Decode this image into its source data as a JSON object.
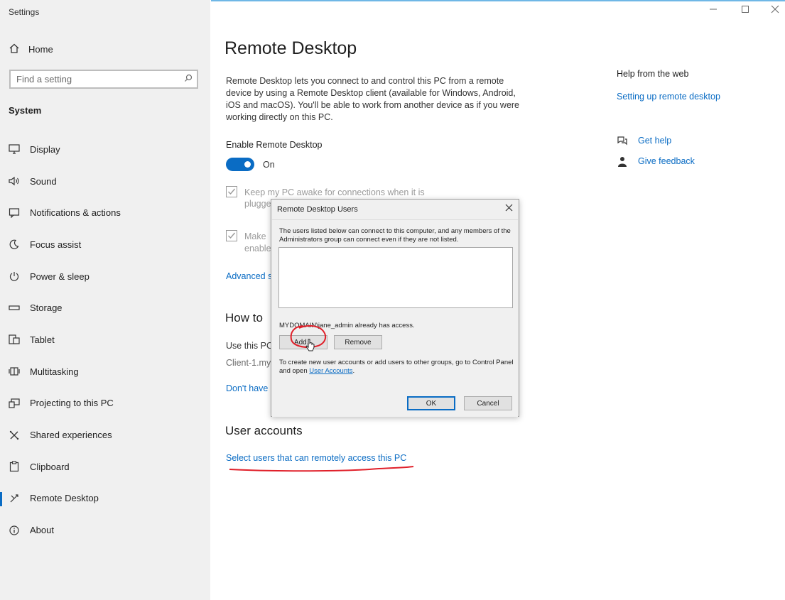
{
  "window": {
    "app_title": "Settings"
  },
  "sidebar": {
    "home_label": "Home",
    "search_placeholder": "Find a setting",
    "section_label": "System",
    "items": [
      {
        "label": "Display",
        "icon": "monitor-icon"
      },
      {
        "label": "Sound",
        "icon": "speaker-icon"
      },
      {
        "label": "Notifications & actions",
        "icon": "notification-icon"
      },
      {
        "label": "Focus assist",
        "icon": "moon-icon"
      },
      {
        "label": "Power & sleep",
        "icon": "power-icon"
      },
      {
        "label": "Storage",
        "icon": "storage-icon"
      },
      {
        "label": "Tablet",
        "icon": "tablet-icon"
      },
      {
        "label": "Multitasking",
        "icon": "multitasking-icon"
      },
      {
        "label": "Projecting to this PC",
        "icon": "projecting-icon"
      },
      {
        "label": "Shared experiences",
        "icon": "shared-icon"
      },
      {
        "label": "Clipboard",
        "icon": "clipboard-icon"
      },
      {
        "label": "Remote Desktop",
        "icon": "remote-desktop-icon",
        "active": true
      },
      {
        "label": "About",
        "icon": "info-icon"
      }
    ]
  },
  "main": {
    "title": "Remote Desktop",
    "description": "Remote Desktop lets you connect to and control this PC from a remote device by using a Remote Desktop client (available for Windows, Android, iOS and macOS). You'll be able to work from another device as if you were working directly on this PC.",
    "enable_label": "Enable Remote Desktop",
    "toggle_state": "On",
    "checkbox1_text": "Keep my PC awake for connections when it is",
    "checkbox1_text2": "plugge",
    "checkbox2_text": "Make",
    "checkbox2_text2": "enable",
    "advanced_link": "Advanced s",
    "howto_heading": "How to",
    "use_this_pc": "Use this PC",
    "client_name": "Client-1.my",
    "dont_have_link": "Don't have",
    "user_accounts_heading": "User accounts",
    "select_users_link": "Select users that can remotely access this PC"
  },
  "right": {
    "help_heading": "Help from the web",
    "setup_link": "Setting up remote desktop",
    "get_help": "Get help",
    "give_feedback": "Give feedback"
  },
  "dialog": {
    "title": "Remote Desktop Users",
    "intro": "The users listed below can connect to this computer, and any members of the Administrators group can connect even if they are not listed.",
    "access_text": "MYDOMAIN\\jane_admin already has access.",
    "add_label": "Add...",
    "remove_label": "Remove",
    "note_text": "To create new user accounts or add users to other groups, go to Control Panel and open ",
    "note_link": "User Accounts",
    "note_end": ".",
    "ok_label": "OK",
    "cancel_label": "Cancel"
  },
  "colors": {
    "accent": "#0a6cc4",
    "annotation": "#e0202a"
  }
}
